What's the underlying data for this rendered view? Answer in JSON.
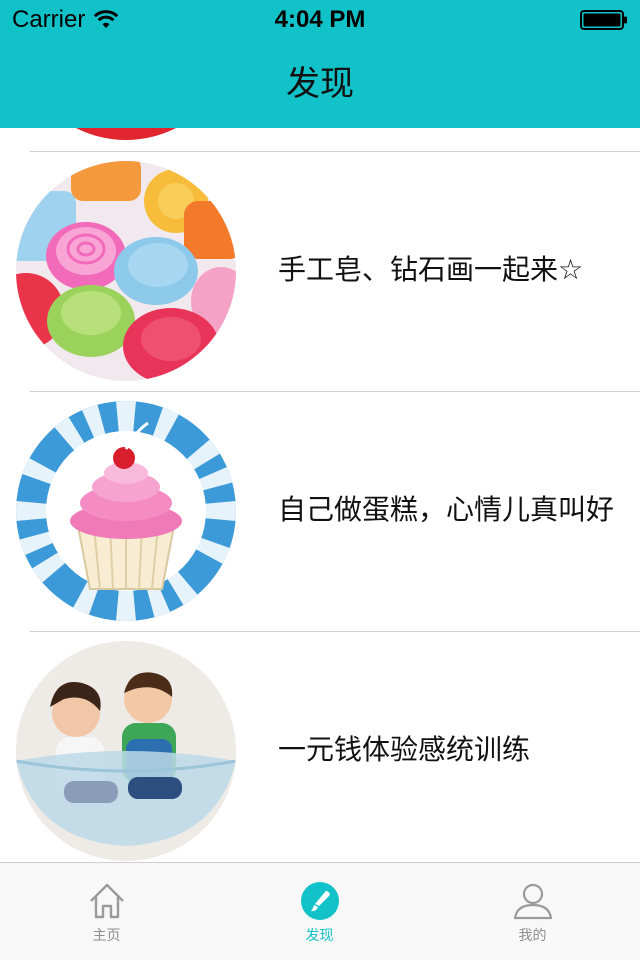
{
  "status_bar": {
    "carrier": "Carrier",
    "time": "4:04 PM",
    "wifi_icon": "wifi-icon",
    "battery_icon": "battery-icon"
  },
  "nav": {
    "title": "发现"
  },
  "list": {
    "items": [
      {
        "title": "手工皂、钻石画一起来☆",
        "image": "handmade-soap-image"
      },
      {
        "title": "自己做蛋糕，心情儿真叫好",
        "image": "cupcake-image"
      },
      {
        "title": "一元钱体验感统训练",
        "image": "kids-balance-image"
      }
    ]
  },
  "tabbar": {
    "tabs": [
      {
        "label": "主页",
        "icon": "home-icon",
        "active": false
      },
      {
        "label": "发现",
        "icon": "brush-icon",
        "active": true
      },
      {
        "label": "我的",
        "icon": "person-icon",
        "active": false
      }
    ]
  },
  "colors": {
    "accent": "#12c2c9",
    "tab_inactive": "#8e8e8e",
    "divider": "#d2d2d2"
  }
}
